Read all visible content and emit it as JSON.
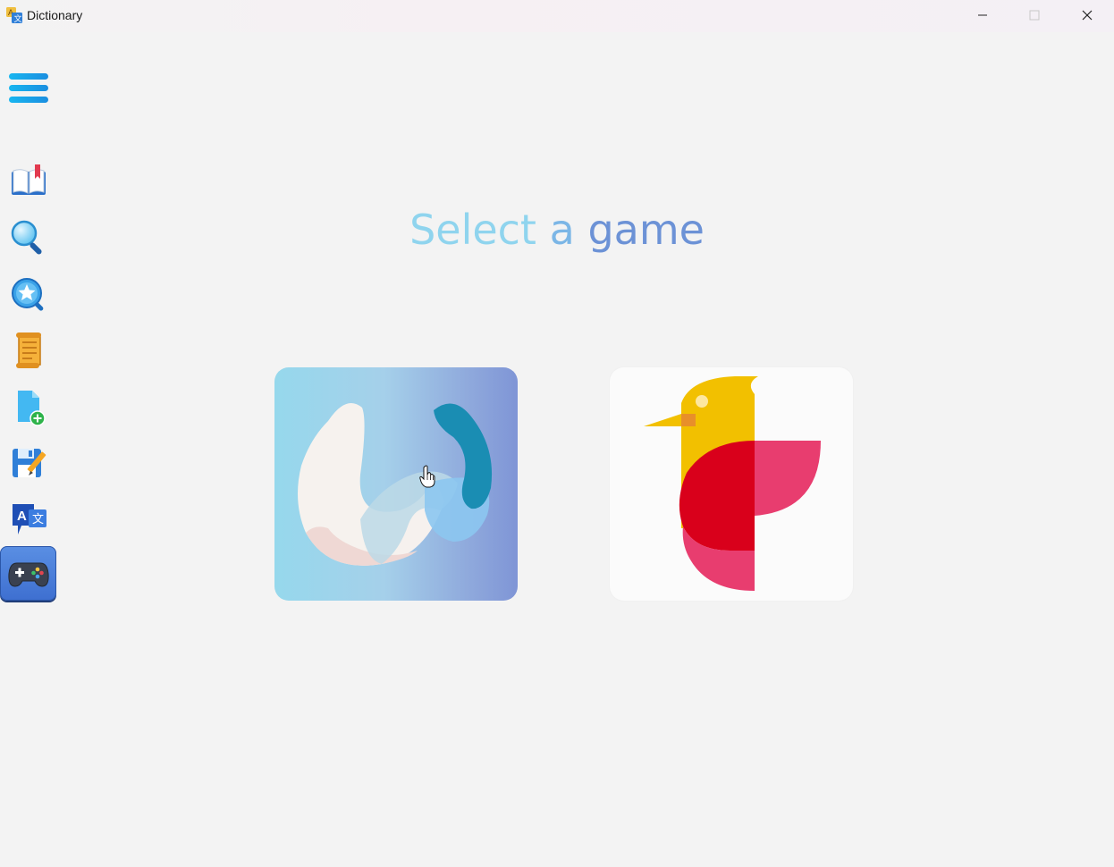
{
  "window": {
    "title": "Dictionary",
    "controls": {
      "minimize": "minimize-icon",
      "maximize": "maximize-icon",
      "close": "close-icon"
    }
  },
  "sidebar": {
    "menu_icon": "hamburger-menu-icon",
    "items": [
      {
        "icon": "book-icon",
        "name": "dictionary",
        "active": false
      },
      {
        "icon": "magnifier-icon",
        "name": "search",
        "active": false
      },
      {
        "icon": "star-search-icon",
        "name": "favorites",
        "active": false
      },
      {
        "icon": "scroll-icon",
        "name": "history",
        "active": false
      },
      {
        "icon": "add-file-icon",
        "name": "add-word",
        "active": false
      },
      {
        "icon": "save-edit-icon",
        "name": "edit",
        "active": false
      },
      {
        "icon": "translate-icon",
        "name": "translate",
        "active": false
      },
      {
        "icon": "gamepad-icon",
        "name": "games",
        "active": true
      }
    ]
  },
  "main": {
    "heading_parts": [
      "Select",
      "a",
      "game"
    ],
    "games": [
      {
        "icon": "wordle-logo-icon",
        "name": "word-game"
      },
      {
        "icon": "bird-logo-icon",
        "name": "bird-game"
      }
    ]
  },
  "colors": {
    "heading_start": "#8fd4ee",
    "heading_end": "#6c92d6",
    "active_nav": "#4a7fdb"
  }
}
